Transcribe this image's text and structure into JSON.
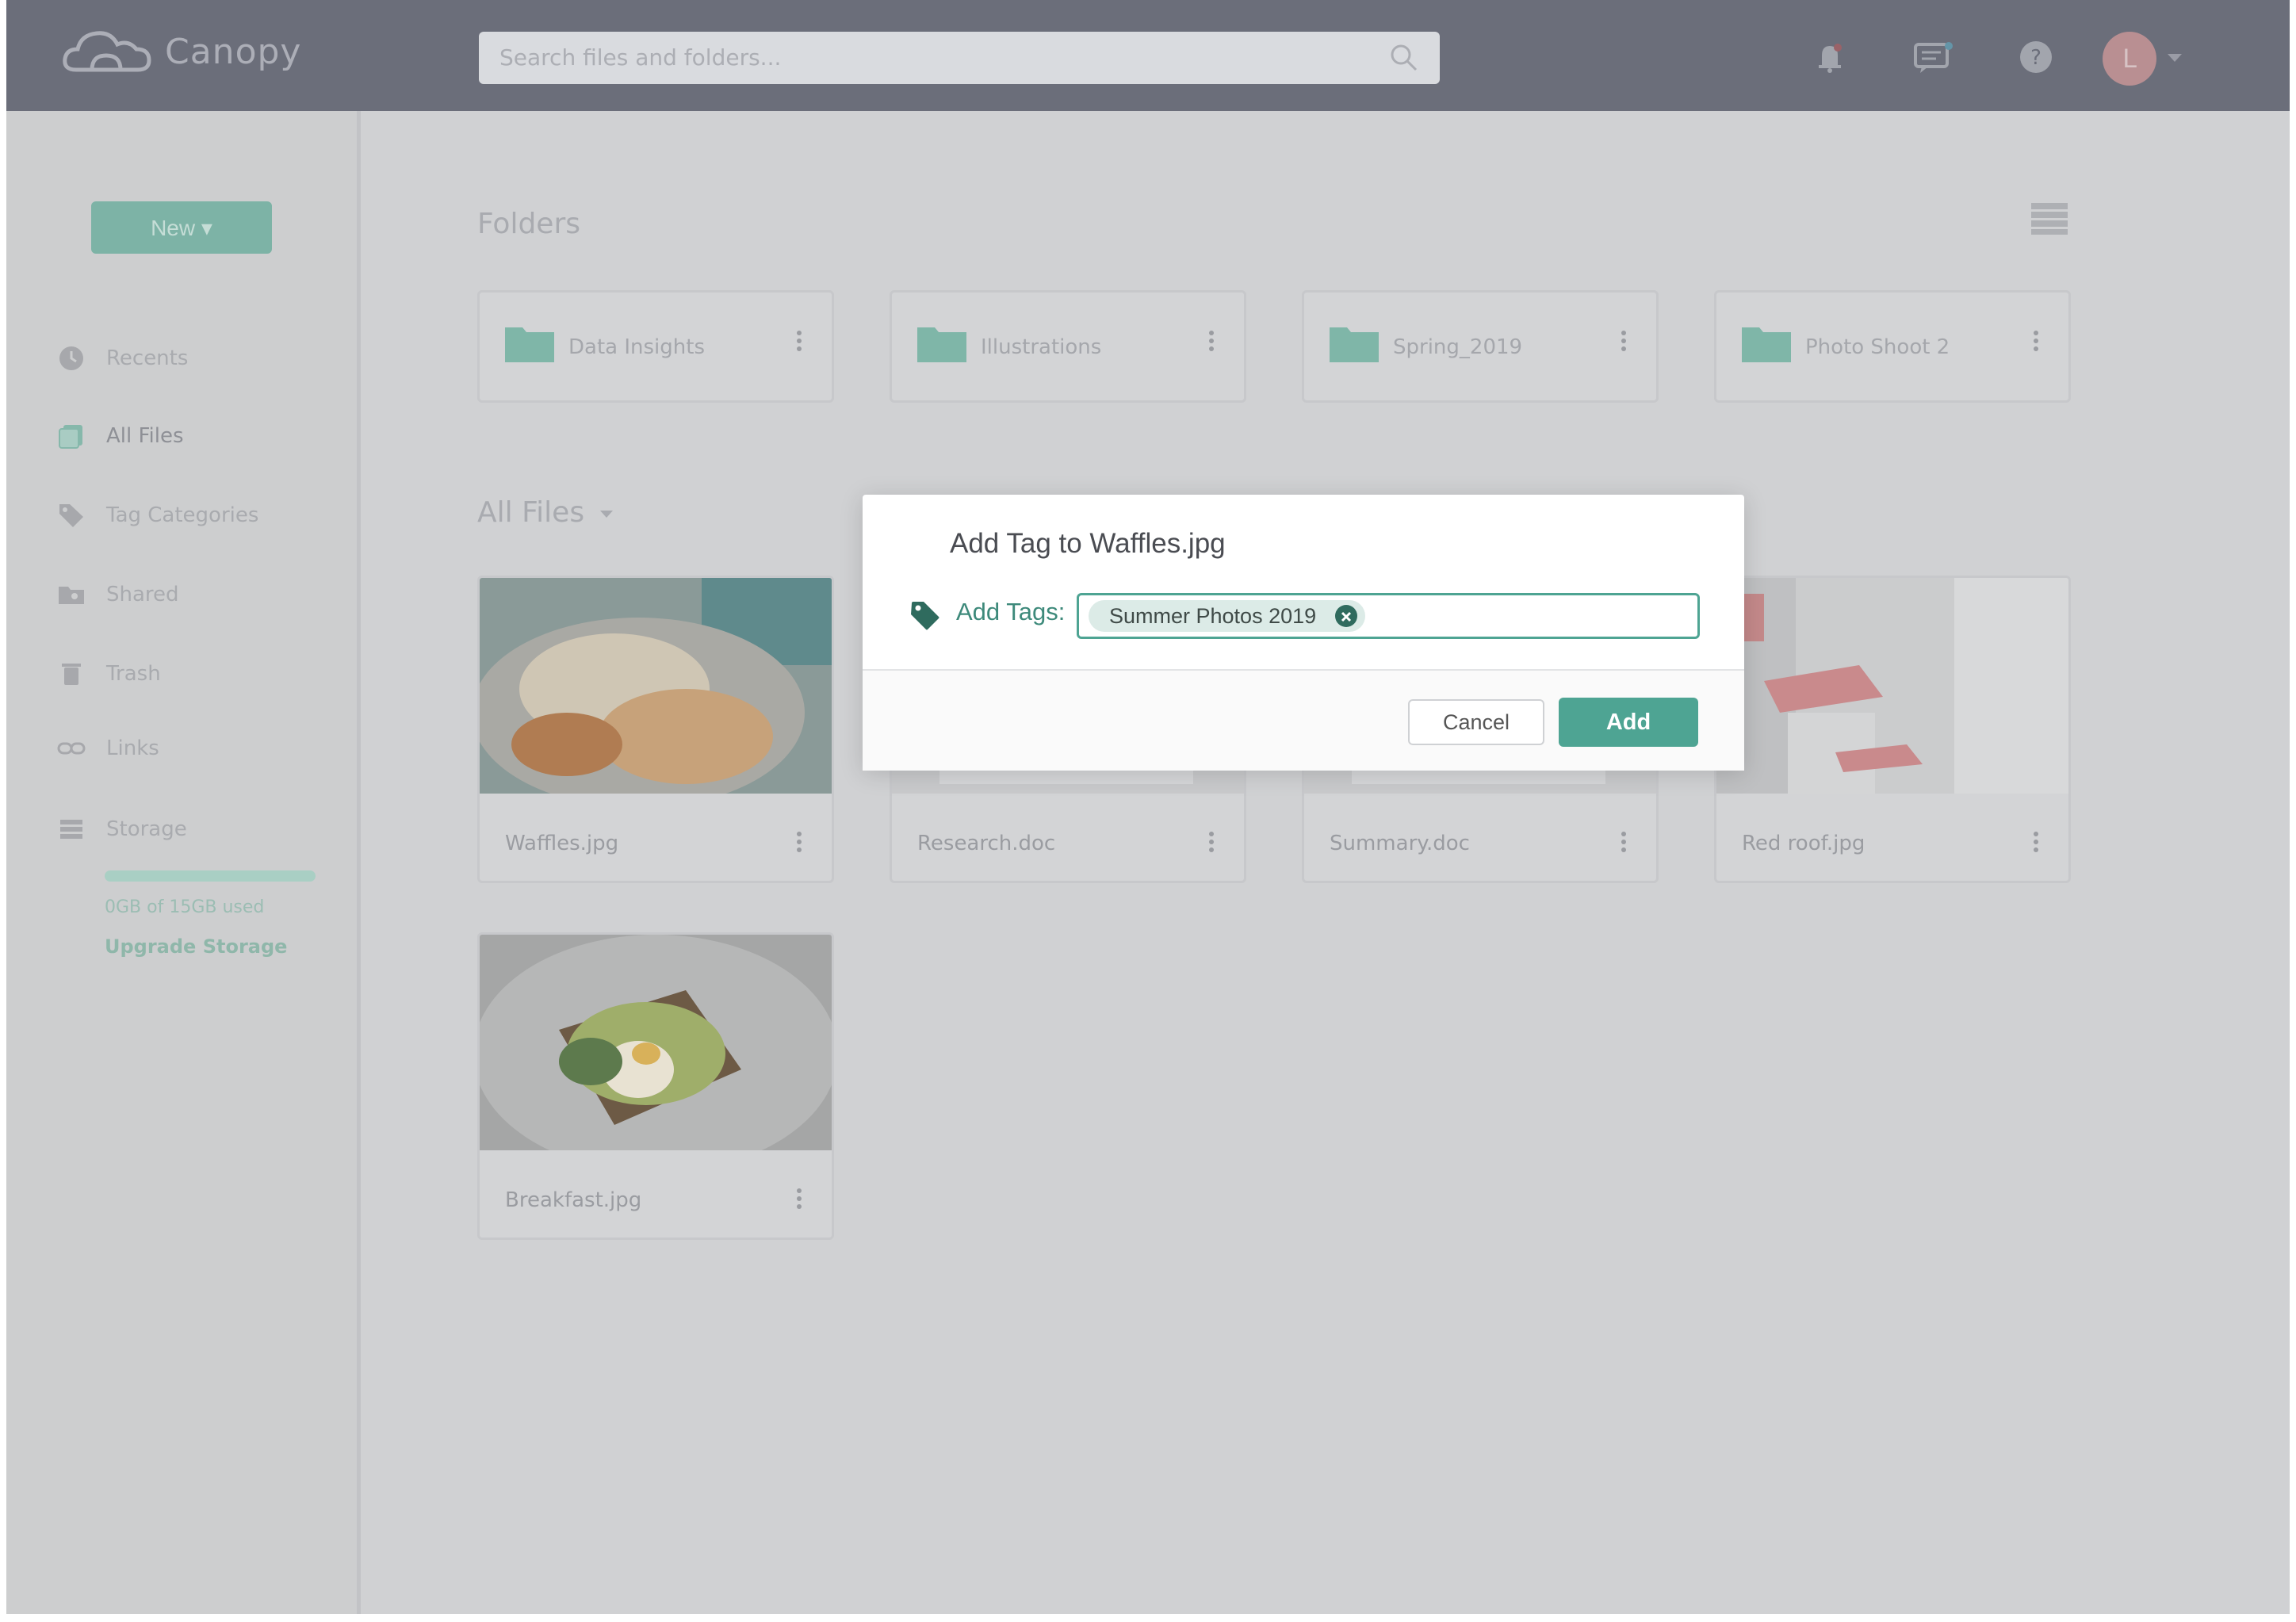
{
  "app": {
    "name": "Canopy"
  },
  "header": {
    "search_placeholder": "Search files and folders...",
    "avatar_initial": "L",
    "icons": [
      "bell-icon",
      "chat-icon",
      "help-icon"
    ]
  },
  "sidebar": {
    "new_label": "New ▾",
    "items": [
      {
        "label": "Recents",
        "icon": "clock-icon"
      },
      {
        "label": "All Files",
        "icon": "files-icon"
      },
      {
        "label": "Tag Categories",
        "icon": "tag-icon"
      },
      {
        "label": "Shared",
        "icon": "shared-folder-icon"
      },
      {
        "label": "Trash",
        "icon": "trash-icon"
      },
      {
        "label": "Links",
        "icon": "link-icon"
      },
      {
        "label": "Storage",
        "icon": "storage-icon"
      }
    ],
    "storage_used": "0GB of 15GB used",
    "upgrade_label": "Upgrade Storage"
  },
  "main": {
    "folders_title": "Folders",
    "folders": [
      {
        "name": "Data Insights"
      },
      {
        "name": "Illustrations"
      },
      {
        "name": "Spring_2019"
      },
      {
        "name": "Photo Shoot 2"
      }
    ],
    "files_title": "All Files",
    "files": [
      {
        "name": "Waffles.jpg"
      },
      {
        "name": "Research.doc"
      },
      {
        "name": "Summary.doc"
      },
      {
        "name": "Red roof.jpg"
      },
      {
        "name": "Breakfast.jpg"
      }
    ]
  },
  "modal": {
    "title": "Add Tag to Waffles.jpg",
    "tags_label": "Add Tags:",
    "tags": [
      "Summer Photos 2019"
    ],
    "cancel_label": "Cancel",
    "add_label": "Add"
  },
  "colors": {
    "accent": "#4ea493",
    "topbar": "#6b6e7a",
    "overlay": "#d0d1d3"
  }
}
